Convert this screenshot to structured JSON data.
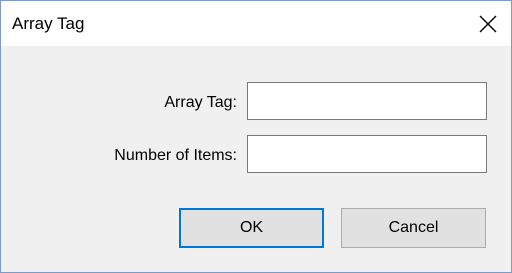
{
  "window": {
    "title": "Array Tag",
    "close_icon": "close-icon"
  },
  "form": {
    "array_tag_label": "Array Tag:",
    "array_tag_value": "",
    "number_of_items_label": "Number of Items:",
    "number_of_items_value": ""
  },
  "buttons": {
    "ok_label": "OK",
    "cancel_label": "Cancel"
  },
  "colors": {
    "border": "#7a9cc7",
    "default_button_accent": "#0078d7",
    "dialog_background": "#f0f0f0"
  }
}
